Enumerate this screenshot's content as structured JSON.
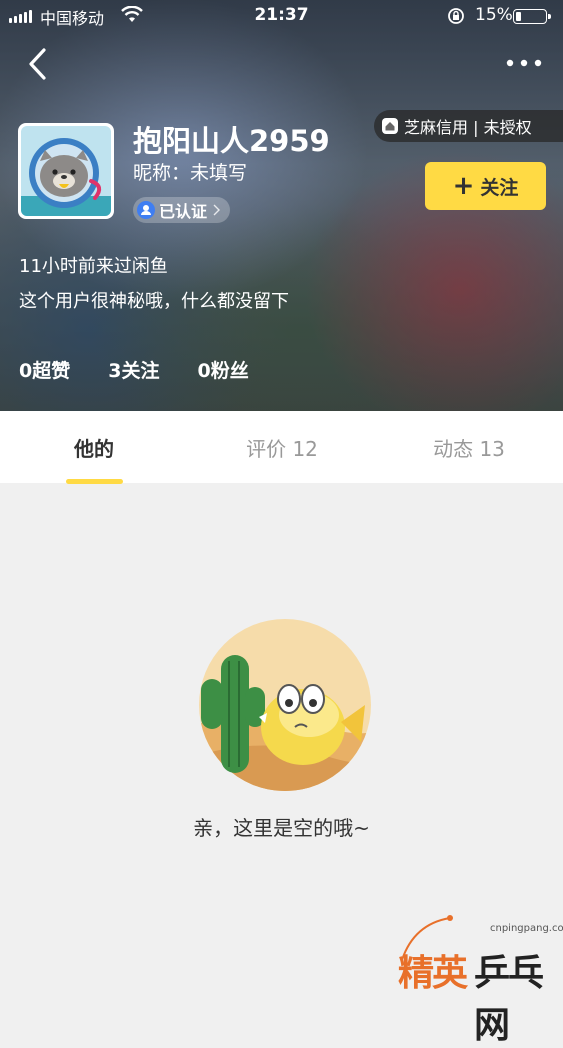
{
  "status_bar": {
    "carrier": "中国移动",
    "time": "21:37",
    "battery": "15%"
  },
  "profile": {
    "username": "抱阳山人2959",
    "nickname": "昵称：未填写",
    "verified_label": "已认证",
    "credit": "芝麻信用 | 未授权",
    "follow_button": "关注",
    "last_visit": "11小时前来过闲鱼",
    "bio": "这个用户很神秘哦，什么都没留下",
    "stats": {
      "likes": "0超赞",
      "following": "3关注",
      "followers": "0粉丝"
    }
  },
  "tabs": [
    {
      "label": "他的"
    },
    {
      "label": "评价 12"
    },
    {
      "label": "动态 13"
    }
  ],
  "empty_state": {
    "message": "亲，这里是空的哦~"
  },
  "watermark": {
    "url": "cnpingpang.com",
    "text_1": "精英",
    "text_2": "乒乓网"
  },
  "colors": {
    "accent": "#ffda44",
    "text_dark": "#333333",
    "text_muted": "#999999",
    "page_bg": "#f0f0f0"
  },
  "icons": [
    "signal-icon",
    "wifi-icon",
    "rotation-lock-icon",
    "battery-icon",
    "back-icon",
    "more-icon",
    "verified-icon",
    "home-icon",
    "plus-icon"
  ]
}
